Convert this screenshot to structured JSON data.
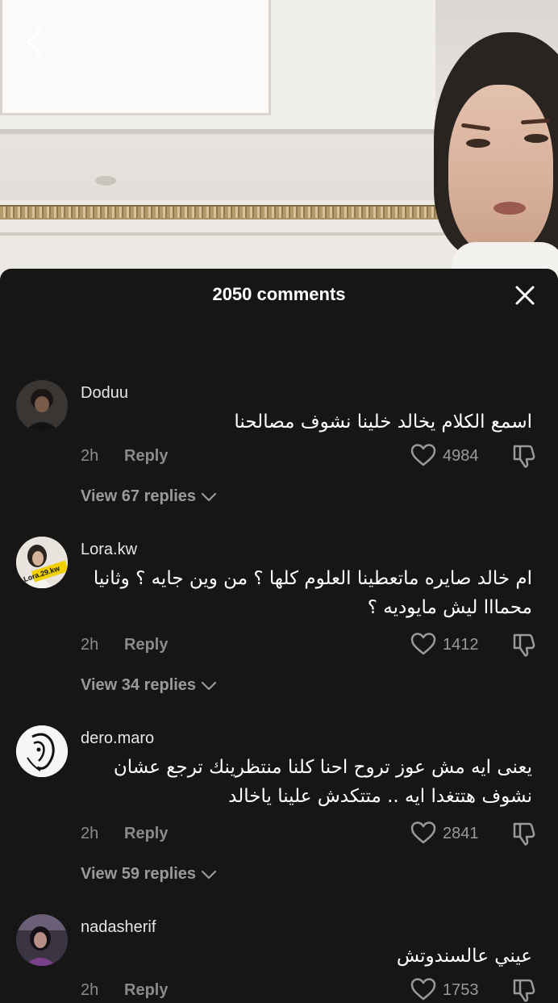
{
  "header": {
    "comment_count_label": "2050 comments"
  },
  "comments": [
    {
      "username": "Doduu",
      "text": "اسمع الكلام يخالد خلينا نشوف مصالحنا",
      "time": "2h",
      "reply_label": "Reply",
      "likes": "4984",
      "view_replies": "View 67 replies"
    },
    {
      "username": "Lora.kw",
      "avatar_text": "Lora.29.kw",
      "text": "ام خالد صايره ماتعطينا العلوم كلها ؟ من وين جايه ؟ وثانيا محمااا ليش مايوديه ؟",
      "time": "2h",
      "reply_label": "Reply",
      "likes": "1412",
      "view_replies": "View 34 replies"
    },
    {
      "username": "dero.maro",
      "text": "يعنى ايه مش عوز تروح احنا كلنا منتظرينك ترجع عشان نشوف هتتغدا ايه .. متتكدش علينا ياخالد",
      "time": "2h",
      "reply_label": "Reply",
      "likes": "2841",
      "view_replies": "View 59 replies"
    },
    {
      "username": "nadasherif",
      "text": "عيني عالسندوتش",
      "time": "2h",
      "reply_label": "Reply",
      "likes": "1753"
    }
  ],
  "colors": {
    "sheet_bg": "#161616",
    "text": "#ffffff",
    "muted": "#8b8b8b"
  }
}
